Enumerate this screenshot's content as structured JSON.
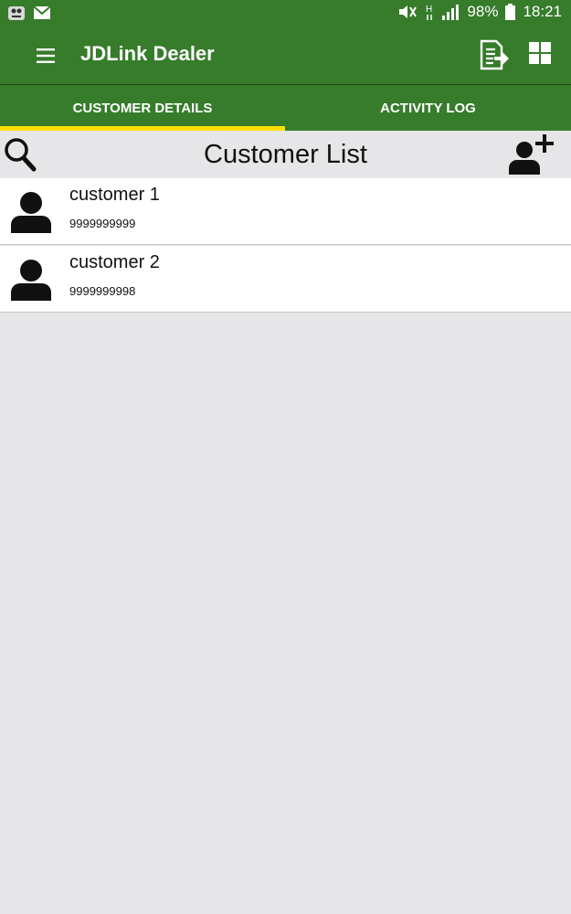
{
  "status_bar": {
    "battery": "98%",
    "time": "18:21"
  },
  "app_bar": {
    "title": "JDLink Dealer"
  },
  "tabs": [
    {
      "label": "CUSTOMER DETAILS",
      "active": true
    },
    {
      "label": "ACTIVITY LOG",
      "active": false
    }
  ],
  "list": {
    "title": "Customer List",
    "customers": [
      {
        "name": "customer 1",
        "phone": "9999999999"
      },
      {
        "name": "customer 2",
        "phone": "9999999998"
      }
    ]
  },
  "colors": {
    "primary": "#367c2b",
    "tab_indicator": "#ffde00",
    "background": "#e6e5e8"
  },
  "icons": [
    "menu-icon",
    "report-export-icon",
    "grid-icon",
    "search-icon",
    "add-user-icon",
    "person-icon"
  ]
}
